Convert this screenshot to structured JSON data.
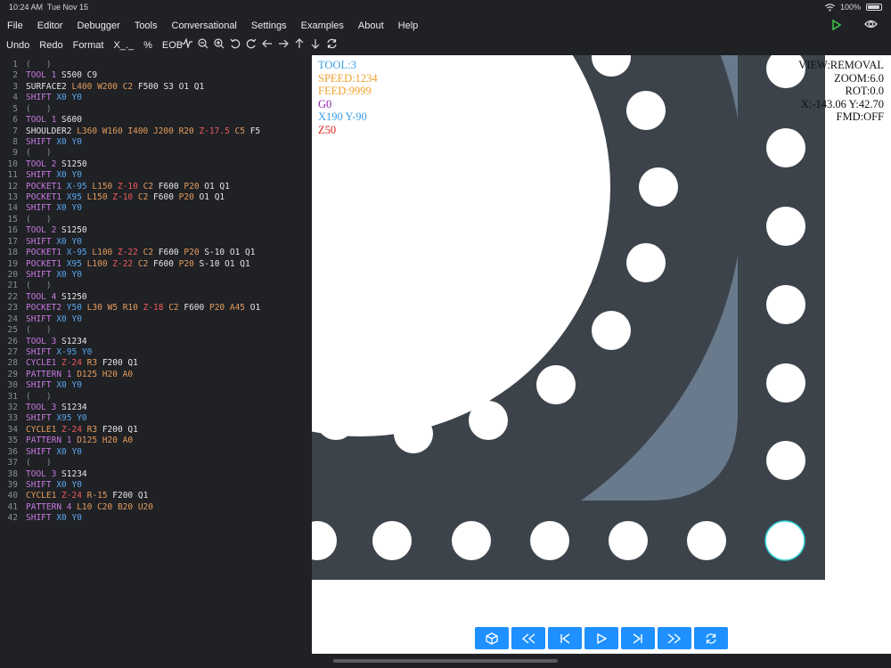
{
  "status_bar": {
    "time": "10:24 AM",
    "date": "Tue Nov 15",
    "battery": "100%"
  },
  "menu": [
    "File",
    "Editor",
    "Debugger",
    "Tools",
    "Conversational",
    "Settings",
    "Examples",
    "About",
    "Help"
  ],
  "toolbar": {
    "undo": "Undo",
    "redo": "Redo",
    "format": "Format",
    "x_macro": "X_._",
    "percent": "%",
    "eob": "EOB"
  },
  "toolbar_icons": [
    "waveform-icon",
    "zoom-out-icon",
    "zoom-in-icon",
    "rotate-left-icon",
    "rotate-right-icon",
    "arrow-left-icon",
    "arrow-right-icon",
    "arrow-up-icon",
    "arrow-down-icon",
    "refresh-icon"
  ],
  "code": [
    [
      [
        "c-gray",
        "(   )"
      ]
    ],
    [
      [
        "c-purple",
        "TOOL 1 "
      ],
      [
        "c-white",
        "S500 C9"
      ]
    ],
    [
      [
        "c-white",
        "SURFACE2 "
      ],
      [
        "c-orange",
        "L400 W200 C2 "
      ],
      [
        "c-white",
        "F500 S3 O1 Q1"
      ]
    ],
    [
      [
        "c-purple",
        "SHIFT "
      ],
      [
        "c-blue",
        "X0 Y0"
      ]
    ],
    [
      [
        "c-gray",
        "(   )"
      ]
    ],
    [
      [
        "c-purple",
        "TOOL 1 "
      ],
      [
        "c-white",
        "S600"
      ]
    ],
    [
      [
        "c-white",
        "SHOULDER2 "
      ],
      [
        "c-orange",
        "L360 W160 I400 J200 R20 "
      ],
      [
        "c-red",
        "Z-17.5 "
      ],
      [
        "c-orange",
        "C5 "
      ],
      [
        "c-white",
        "F5"
      ]
    ],
    [
      [
        "c-purple",
        "SHIFT "
      ],
      [
        "c-blue",
        "X0 Y0"
      ]
    ],
    [
      [
        "c-gray",
        "(   )"
      ]
    ],
    [
      [
        "c-purple",
        "TOOL 2 "
      ],
      [
        "c-white",
        "S1250"
      ]
    ],
    [
      [
        "c-purple",
        "SHIFT "
      ],
      [
        "c-blue",
        "X0 Y0"
      ]
    ],
    [
      [
        "c-purple",
        "POCKET1 "
      ],
      [
        "c-blue",
        "X-95 "
      ],
      [
        "c-orange",
        "L150 "
      ],
      [
        "c-red",
        "Z-10 "
      ],
      [
        "c-orange",
        "C2 "
      ],
      [
        "c-white",
        "F600 "
      ],
      [
        "c-orange",
        "P20 "
      ],
      [
        "c-white",
        "O1 Q1"
      ]
    ],
    [
      [
        "c-purple",
        "POCKET1 "
      ],
      [
        "c-blue",
        "X95 "
      ],
      [
        "c-orange",
        "L150 "
      ],
      [
        "c-red",
        "Z-10 "
      ],
      [
        "c-orange",
        "C2 "
      ],
      [
        "c-white",
        "F600 "
      ],
      [
        "c-orange",
        "P20 "
      ],
      [
        "c-white",
        "O1 Q1"
      ]
    ],
    [
      [
        "c-purple",
        "SHIFT "
      ],
      [
        "c-blue",
        "X0 Y0"
      ]
    ],
    [
      [
        "c-gray",
        "(   )"
      ]
    ],
    [
      [
        "c-purple",
        "TOOL 2 "
      ],
      [
        "c-white",
        "S1250"
      ]
    ],
    [
      [
        "c-purple",
        "SHIFT "
      ],
      [
        "c-blue",
        "X0 Y0"
      ]
    ],
    [
      [
        "c-purple",
        "POCKET1 "
      ],
      [
        "c-blue",
        "X-95 "
      ],
      [
        "c-orange",
        "L100 "
      ],
      [
        "c-red",
        "Z-22 "
      ],
      [
        "c-orange",
        "C2 "
      ],
      [
        "c-white",
        "F600 "
      ],
      [
        "c-orange",
        "P20 "
      ],
      [
        "c-white",
        "S-10 O1 Q1"
      ]
    ],
    [
      [
        "c-purple",
        "POCKET1 "
      ],
      [
        "c-blue",
        "X95 "
      ],
      [
        "c-orange",
        "L100 "
      ],
      [
        "c-red",
        "Z-22 "
      ],
      [
        "c-orange",
        "C2 "
      ],
      [
        "c-white",
        "F600 "
      ],
      [
        "c-orange",
        "P20 "
      ],
      [
        "c-white",
        "S-10 O1 Q1"
      ]
    ],
    [
      [
        "c-purple",
        "SHIFT "
      ],
      [
        "c-blue",
        "X0 Y0"
      ]
    ],
    [
      [
        "c-gray",
        "(   )"
      ]
    ],
    [
      [
        "c-purple",
        "TOOL 4 "
      ],
      [
        "c-white",
        "S1250"
      ]
    ],
    [
      [
        "c-purple",
        "POCKET2 "
      ],
      [
        "c-blue",
        "Y50 "
      ],
      [
        "c-orange",
        "L30 W5 R10 "
      ],
      [
        "c-red",
        "Z-18 "
      ],
      [
        "c-orange",
        "C2 "
      ],
      [
        "c-white",
        "F600 "
      ],
      [
        "c-orange",
        "P20 A45 "
      ],
      [
        "c-white",
        "O1"
      ]
    ],
    [
      [
        "c-purple",
        "SHIFT "
      ],
      [
        "c-blue",
        "X0 Y0"
      ]
    ],
    [
      [
        "c-gray",
        "(   )"
      ]
    ],
    [
      [
        "c-purple",
        "TOOL 3 "
      ],
      [
        "c-white",
        "S1234"
      ]
    ],
    [
      [
        "c-purple",
        "SHIFT "
      ],
      [
        "c-blue",
        "X-95 Y0"
      ]
    ],
    [
      [
        "c-purple",
        "CYCLE1 "
      ],
      [
        "c-red",
        "Z-24 "
      ],
      [
        "c-orange",
        "R3 "
      ],
      [
        "c-white",
        "F200 Q1"
      ]
    ],
    [
      [
        "c-purple",
        "PATTERN 1 "
      ],
      [
        "c-orange",
        "D125 H20 A0"
      ]
    ],
    [
      [
        "c-purple",
        "SHIFT "
      ],
      [
        "c-blue",
        "X0 Y0"
      ]
    ],
    [
      [
        "c-gray",
        "(   )"
      ]
    ],
    [
      [
        "c-purple",
        "TOOL 3 "
      ],
      [
        "c-white",
        "S1234"
      ]
    ],
    [
      [
        "c-purple",
        "SHIFT "
      ],
      [
        "c-blue",
        "X95 Y0"
      ]
    ],
    [
      [
        "c-orange",
        "CYCLE1 "
      ],
      [
        "c-red",
        "Z-24 "
      ],
      [
        "c-orange",
        "R3 "
      ],
      [
        "c-white",
        "F200 Q1"
      ]
    ],
    [
      [
        "c-purple",
        "PATTERN 1 "
      ],
      [
        "c-orange",
        "D125 H20 A0"
      ]
    ],
    [
      [
        "c-purple",
        "SHIFT "
      ],
      [
        "c-blue",
        "X0 Y0"
      ]
    ],
    [
      [
        "c-gray",
        "(   )"
      ]
    ],
    [
      [
        "c-purple",
        "TOOL 3 "
      ],
      [
        "c-white",
        "S1234"
      ]
    ],
    [
      [
        "c-purple",
        "SHIFT "
      ],
      [
        "c-blue",
        "X0 Y0"
      ]
    ],
    [
      [
        "c-orange",
        "CYCLE1 "
      ],
      [
        "c-red",
        "Z-24 "
      ],
      [
        "c-orange",
        "R-15 "
      ],
      [
        "c-white",
        "F200 Q1"
      ]
    ],
    [
      [
        "c-purple",
        "PATTERN 4 "
      ],
      [
        "c-orange",
        "L10 C20 B20 U20"
      ]
    ],
    [
      [
        "c-purple",
        "SHIFT "
      ],
      [
        "c-blue",
        "X0 Y0"
      ]
    ]
  ],
  "overlay_left": [
    {
      "text": "TOOL:3",
      "color": "#3a9ee6"
    },
    {
      "text": "SPEED:1234",
      "color": "#f0a030"
    },
    {
      "text": "FEED:9999",
      "color": "#f0a030"
    },
    {
      "text": "G0",
      "color": "#8b1aa8"
    },
    {
      "text": "X190 Y-90",
      "color": "#3a9ee6"
    },
    {
      "text": "Z50",
      "color": "#e02020"
    }
  ],
  "overlay_right": [
    "VIEW:REMOVAL",
    "ZOOM:6.0",
    "ROT:0.0",
    "X:-143.06 Y:42.70",
    "FMD:OFF"
  ],
  "playback_controls": [
    "cube-icon",
    "rewind-icon",
    "skip-back-icon",
    "play-icon",
    "skip-forward-icon",
    "fast-forward-icon",
    "repeat-icon"
  ],
  "colors": {
    "stock_dark": "#3c434b",
    "pocket_light": "#687a8c",
    "hole_white": "#ffffff",
    "accent_blue": "#1e90ff",
    "run_green": "#3ec04a"
  }
}
